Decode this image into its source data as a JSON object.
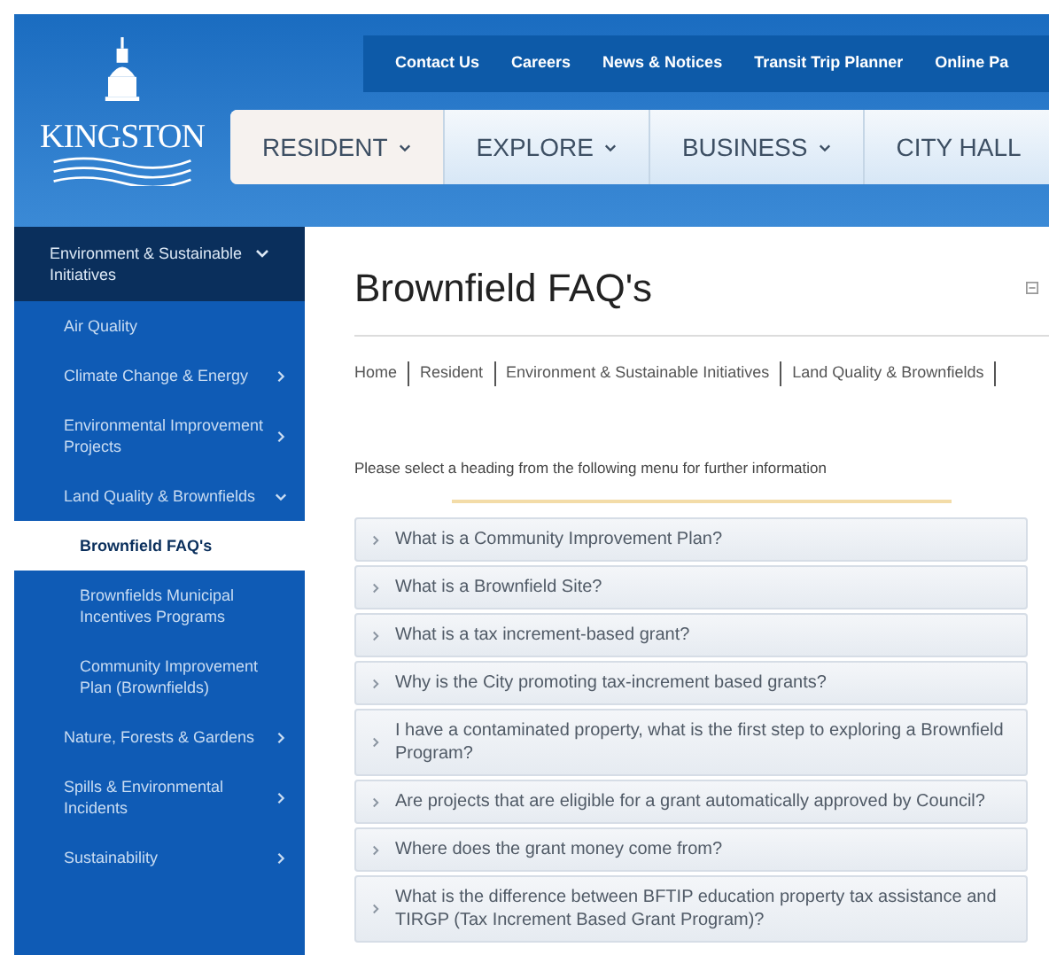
{
  "logo": {
    "text": "KINGSTON"
  },
  "top_links": [
    "Contact Us",
    "Careers",
    "News & Notices",
    "Transit Trip Planner",
    "Online Pa"
  ],
  "main_nav": [
    {
      "label": "RESIDENT",
      "selected": true,
      "dropdown": true
    },
    {
      "label": "EXPLORE",
      "selected": false,
      "dropdown": true
    },
    {
      "label": "BUSINESS",
      "selected": false,
      "dropdown": true
    },
    {
      "label": "CITY HALL",
      "selected": false,
      "dropdown": false
    }
  ],
  "sidebar": {
    "heading": {
      "label": "Environment & Sustainable Initiatives",
      "expanded": true
    },
    "items": [
      {
        "label": "Air Quality",
        "has_submenu": false,
        "selected": false
      },
      {
        "label": "Climate Change & Energy",
        "has_submenu": true,
        "expanded": false,
        "selected": false
      },
      {
        "label": "Environmental Improvement Projects",
        "has_submenu": true,
        "expanded": false,
        "selected": false
      },
      {
        "label": "Land Quality & Brownfields",
        "has_submenu": true,
        "expanded": true,
        "selected": false,
        "children": [
          {
            "label": "Brownfield FAQ's",
            "selected": true
          },
          {
            "label": "Brownfields Municipal Incentives Programs",
            "selected": false
          },
          {
            "label": "Community Improvement Plan (Brownfields)",
            "selected": false
          }
        ]
      },
      {
        "label": "Nature, Forests & Gardens",
        "has_submenu": true,
        "expanded": false,
        "selected": false
      },
      {
        "label": "Spills & Environmental Incidents",
        "has_submenu": true,
        "expanded": false,
        "selected": false
      },
      {
        "label": "Sustainability",
        "has_submenu": true,
        "expanded": false,
        "selected": false
      }
    ]
  },
  "page_title": "Brownfield FAQ's",
  "breadcrumb": [
    "Home",
    "Resident",
    "Environment & Sustainable Initiatives",
    "Land Quality & Brownfields"
  ],
  "intro": "Please select a heading from the following menu for further information",
  "faq": [
    {
      "question": "What is a Community Improvement Plan?",
      "expanded": false
    },
    {
      "question": "What is a Brownfield Site?",
      "expanded": false
    },
    {
      "question": "What is a tax increment-based grant?",
      "expanded": false
    },
    {
      "question": "Why is the City promoting tax-increment based grants?",
      "expanded": false
    },
    {
      "question": "I have a contaminated property, what is the first step to exploring a Brownfield Program?",
      "expanded": false
    },
    {
      "question": "Are projects that are eligible for a grant automatically approved by Council?",
      "expanded": false
    },
    {
      "question": "Where does the grant money come from?",
      "expanded": false
    },
    {
      "question": "What is the difference between BFTIP education property tax assistance and TIRGP (Tax Increment Based Grant Program)?",
      "expanded": false
    }
  ]
}
